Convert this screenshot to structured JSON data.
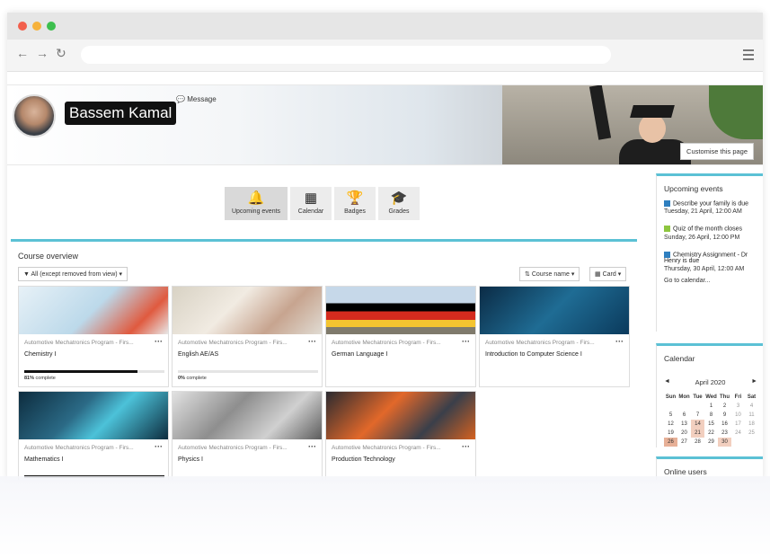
{
  "profile": {
    "name": "Bassem Kamal",
    "message_label": "Message",
    "customise_label": "Customise this page"
  },
  "tabs": [
    {
      "label": "Upcoming events",
      "icon": "bell-icon"
    },
    {
      "label": "Calendar",
      "icon": "calendar-icon"
    },
    {
      "label": "Badges",
      "icon": "trophy-icon"
    },
    {
      "label": "Grades",
      "icon": "graduation-cap-icon"
    }
  ],
  "course_overview": {
    "title": "Course overview",
    "filter_label": "All (except removed from view)",
    "sort_label": "Course name",
    "view_label": "Card",
    "courses": [
      {
        "category": "Automotive Mechatronics Program - Firs...",
        "name": "Chemistry I",
        "progress_pct": "81%",
        "progress_text": "complete",
        "progress": 0.81
      },
      {
        "category": "Automotive Mechatronics Program - Firs...",
        "name": "English AE/AS",
        "progress_pct": "0%",
        "progress_text": "complete",
        "progress": 0
      },
      {
        "category": "Automotive Mechatronics Program - Firs...",
        "name": "German Language I"
      },
      {
        "category": "Automotive Mechatronics Program - Firs...",
        "name": "Introduction to Computer Science I"
      },
      {
        "category": "Automotive Mechatronics Program - Firs...",
        "name": "Mathematics I",
        "progress": 1.0
      },
      {
        "category": "Automotive Mechatronics Program - Firs...",
        "name": "Physics I"
      },
      {
        "category": "Automotive Mechatronics Program - Firs...",
        "name": "Production Technology"
      }
    ]
  },
  "upcoming": {
    "title": "Upcoming events",
    "events": [
      {
        "title": "Describe your family is due",
        "date": "Tuesday, 21 April, 12:00 AM",
        "color": "#2f7fbf"
      },
      {
        "title": "Quiz of the month closes",
        "date": "Sunday, 26 April, 12:00 PM",
        "color": "#8ec63f"
      },
      {
        "title": "Chemistry Assignment - Dr Henry is due",
        "date": "Thursday, 30 April, 12:00 AM",
        "color": "#2f7fbf"
      }
    ],
    "goto": "Go to calendar..."
  },
  "calendar": {
    "title": "Calendar",
    "month": "April 2020",
    "prev": "◄",
    "next": "►",
    "days": [
      "Sun",
      "Mon",
      "Tue",
      "Wed",
      "Thu",
      "Fri",
      "Sat"
    ],
    "weeks": [
      [
        "",
        "",
        "",
        "1",
        "2",
        "3",
        "4"
      ],
      [
        "5",
        "6",
        "7",
        "8",
        "9",
        "10",
        "11"
      ],
      [
        "12",
        "13",
        "14",
        "15",
        "16",
        "17",
        "18"
      ],
      [
        "19",
        "20",
        "21",
        "22",
        "23",
        "24",
        "25"
      ],
      [
        "26",
        "27",
        "28",
        "29",
        "30",
        "",
        ""
      ]
    ]
  },
  "online_users": {
    "title": "Online users"
  }
}
